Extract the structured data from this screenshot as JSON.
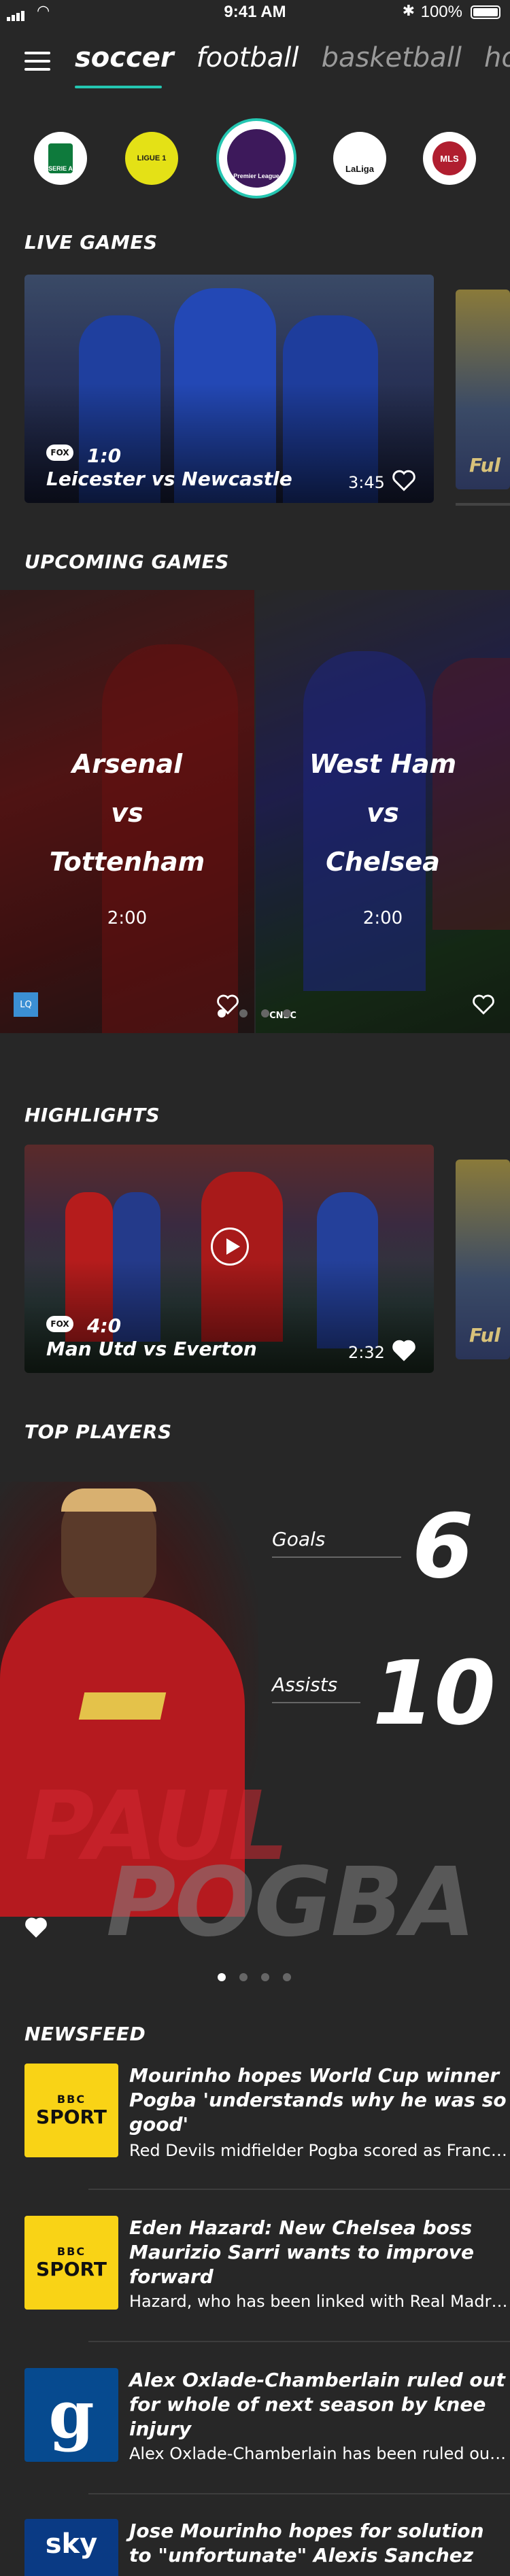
{
  "status_bar": {
    "time": "9:41 AM",
    "battery": "100%"
  },
  "sports_tabs": [
    "soccer",
    "football",
    "basketball",
    "hoc"
  ],
  "leagues": [
    {
      "name": "Serie A",
      "label": "SERIE A",
      "color": "#0e7a3c"
    },
    {
      "name": "Ligue 1",
      "label": "LIGUE 1",
      "color": "#d6d600"
    },
    {
      "name": "Premier League",
      "label": "Premier League",
      "color": "#3d195b"
    },
    {
      "name": "LaLiga",
      "label": "LaLiga",
      "color": "#e8202a"
    },
    {
      "name": "MLS",
      "label": "MLS",
      "color": "#b01e2f"
    }
  ],
  "live_games": {
    "title": "LIVE GAMES",
    "cards": [
      {
        "network": "FOX",
        "score": "1:0",
        "teams": "Leicester vs Newcastle",
        "time": "3:45"
      },
      {
        "teams": "Ful"
      }
    ]
  },
  "upcoming_games": {
    "title": "UPCOMING GAMES",
    "cards": [
      {
        "home": "Arsenal",
        "vs": "vs",
        "away": "Tottenham",
        "time": "2:00",
        "network": "LQ"
      },
      {
        "home": "West Ham",
        "vs": "vs",
        "away": "Chelsea",
        "time": "2:00",
        "network": "CNBC"
      }
    ]
  },
  "highlights": {
    "title": "HIGHLIGHTS",
    "cards": [
      {
        "network": "FOX",
        "score": "4:0",
        "teams": "Man Utd vs Everton",
        "time": "2:32"
      },
      {
        "teams": "Ful"
      }
    ]
  },
  "top_players": {
    "title": "TOP PLAYERS",
    "player": {
      "first_name": "PAUL",
      "last_name": "POGBA"
    },
    "stats": [
      {
        "label": "Goals",
        "value": "6"
      },
      {
        "label": "Assists",
        "value": "10"
      }
    ]
  },
  "newsfeed": {
    "title": "NEWSFEED",
    "items": [
      {
        "source_label_top": "BBC",
        "source_label": "SPORT",
        "source_color": "#f9d316",
        "title": "Mourinho hopes World Cup winner Pogba 'understands why he was so good'",
        "summary": "Red Devils midfielder Pogba scored as France..."
      },
      {
        "source_label_top": "BBC",
        "source_label": "SPORT",
        "source_color": "#f9d316",
        "title": "Eden Hazard: New Chelsea boss Maurizio Sarri wants to improve forward",
        "summary": "Hazard, who has been linked with Real Madrid..."
      },
      {
        "source_label_top": "",
        "source_label": "g",
        "source_color": "#064a8f",
        "title": "Alex Oxlade-Chamberlain ruled out for whole of next season by knee injury",
        "summary": "Alex Oxlade-Chamberlain has been ruled out..."
      },
      {
        "source_label_top": "",
        "source_label": "sky",
        "source_color": "#0a3a84",
        "title": "Jose Mourinho hopes for solution to \"unfortunate\" Alexis Sanchez",
        "summary": ""
      }
    ]
  },
  "colors": {
    "background": "#272727",
    "accent": "#24c6b1",
    "text": "#ffffff"
  }
}
